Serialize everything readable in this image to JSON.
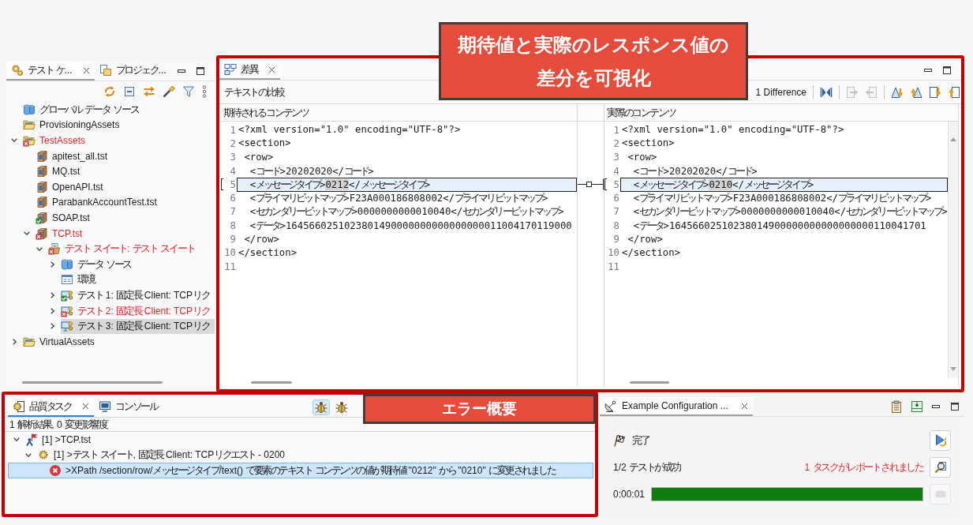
{
  "callouts": [
    {
      "text": "期待値と実際のレスポンス値の差分を可視化"
    },
    {
      "text": "エラー概要"
    }
  ],
  "test_explorer": {
    "tabs": [
      {
        "label": "テスト ケ...",
        "selected": true
      },
      {
        "label": "プロジェク...",
        "selected": false
      }
    ],
    "tree": [
      {
        "label": "グローバル データ ソース",
        "kind": "datasource",
        "failed": false,
        "passed": false,
        "selected": false
      },
      {
        "label": "ProvisioningAssets",
        "kind": "folder",
        "failed": false,
        "passed": false,
        "selected": false
      },
      {
        "label": "TestAssets",
        "kind": "folder",
        "failed": true,
        "passed": false,
        "expanded": true,
        "selected": false,
        "children": [
          {
            "label": "apitest_all.tst",
            "kind": "file",
            "failed": false,
            "passed": false,
            "selected": false
          },
          {
            "label": "MQ.tst",
            "kind": "file",
            "failed": false,
            "passed": false,
            "selected": false
          },
          {
            "label": "OpenAPI.tst",
            "kind": "file",
            "failed": false,
            "passed": false,
            "selected": false
          },
          {
            "label": "ParabankAccountTest.tst",
            "kind": "file",
            "failed": false,
            "passed": false,
            "selected": false
          },
          {
            "label": "SOAP.tst",
            "kind": "file",
            "failed": false,
            "passed": true,
            "selected": false
          },
          {
            "label": "TCP.tst",
            "kind": "file",
            "failed": true,
            "passed": false,
            "expanded": true,
            "selected": false,
            "children": [
              {
                "label": "テスト スイート: テスト スイート",
                "kind": "suite",
                "failed": true,
                "passed": false,
                "expanded": true,
                "selected": false,
                "children": [
                  {
                    "label": "データ ソース",
                    "kind": "datasource",
                    "failed": false,
                    "passed": false,
                    "expanded": false,
                    "selected": false
                  },
                  {
                    "label": "環境",
                    "kind": "environment",
                    "failed": false,
                    "passed": false,
                    "selected": false
                  },
                  {
                    "label": "テスト 1: 固定長 Client: TCPリク",
                    "kind": "test",
                    "failed": false,
                    "passed": true,
                    "expanded": false,
                    "selected": false
                  },
                  {
                    "label": "テスト 2: 固定長 Client: TCPリク",
                    "kind": "test",
                    "failed": true,
                    "passed": false,
                    "expanded": false,
                    "selected": false
                  },
                  {
                    "label": "テスト 3: 固定長 Client: TCPリク",
                    "kind": "test",
                    "failed": false,
                    "passed": false,
                    "expanded": false,
                    "selected": true
                  }
                ]
              }
            ]
          }
        ]
      },
      {
        "label": "VirtualAssets",
        "kind": "folder",
        "failed": false,
        "passed": false,
        "expanded": false,
        "selected": false
      }
    ]
  },
  "diff_view": {
    "tab": {
      "label": "差異",
      "selected": true
    },
    "title": "テキストの比較",
    "difference_count": "1 Difference",
    "toolbar": [
      {
        "kind": "copy_all",
        "disabled": false
      },
      {
        "kind": "copy_right",
        "disabled": true
      },
      {
        "kind": "copy_left",
        "disabled": true
      },
      {
        "kind": "next_difference",
        "disabled": false
      },
      {
        "kind": "previous_difference",
        "disabled": false
      },
      {
        "kind": "next_change",
        "disabled": false
      },
      {
        "kind": "previous_change",
        "disabled": false
      }
    ],
    "panes": [
      {
        "header": "期待されるコンテンツ",
        "lines": [
          {
            "number": "1",
            "text": "<?xml version=\"1.0\" encoding=\"UTF-8\"?>",
            "changed": false
          },
          {
            "number": "2",
            "text": "<section>",
            "changed": false
          },
          {
            "number": "3",
            "text": " <row>",
            "changed": false
          },
          {
            "number": "4",
            "text": "  <コード>20202020</コード>",
            "changed": false
          },
          {
            "number": "5",
            "text": "  <メッセージタイプ>",
            "diff": "0212",
            "tail": "</メッセージタイプ>",
            "changed": true
          },
          {
            "number": "6",
            "text": "  <プライマリビットマップ>F23A000186808002</プライマリビットマップ>",
            "changed": false
          },
          {
            "number": "7",
            "text": "  <セカンダリービットマップ>0000000000010040</セカンダリービットマップ>",
            "changed": false
          },
          {
            "number": "8",
            "text": "  <データ>1645660251023801490000000000000000011004170119000",
            "changed": false
          },
          {
            "number": "9",
            "text": " </row>",
            "changed": false
          },
          {
            "number": "10",
            "text": "</section>",
            "changed": false
          },
          {
            "number": "11",
            "changed": false
          }
        ]
      },
      {
        "header": "実際のコンテンツ",
        "lines": [
          {
            "number": "1",
            "text": "<?xml version=\"1.0\" encoding=\"UTF-8\"?>",
            "changed": false
          },
          {
            "number": "2",
            "text": "<section>",
            "changed": false
          },
          {
            "number": "3",
            "text": " <row>",
            "changed": false
          },
          {
            "number": "4",
            "text": "  <コード>20202020</コード>",
            "changed": false
          },
          {
            "number": "5",
            "text": "  <メッセージタイプ>",
            "diff": "0210",
            "tail": "</メッセージタイプ>",
            "changed": true
          },
          {
            "number": "6",
            "text": "  <プライマリビットマップ>F23A000186808002</プライマリビットマップ>",
            "changed": false
          },
          {
            "number": "7",
            "text": "  <セカンダリービットマップ>0000000000010040</セカンダリービットマップ>",
            "changed": false
          },
          {
            "number": "8",
            "text": "  <データ>16456602510238014900000000000000000110041701",
            "changed": false
          },
          {
            "number": "9",
            "text": " </row>",
            "changed": false
          },
          {
            "number": "10",
            "text": "</section>",
            "changed": false
          },
          {
            "number": "11",
            "changed": false
          }
        ]
      }
    ]
  },
  "quality_tasks": {
    "tabs": [
      {
        "label": "品質タスク",
        "selected": true
      },
      {
        "label": "コンソール",
        "selected": false
      }
    ],
    "toolbar": [
      {
        "pressed": true
      },
      {
        "pressed": false
      }
    ],
    "summary": "1 解析結果, 0 変更影響度",
    "tree": [
      {
        "label": "[1] >TCP.tst",
        "kind": "file",
        "expanded": true,
        "selected": false,
        "children": [
          {
            "label": "[1] >テスト スイート, 固定長 Client: TCPリクエスト - 0200",
            "kind": "test",
            "expanded": true,
            "selected": false,
            "children": [
              {
                "label": ">XPath /section/row/メッセージタイプ/text() で要素のテキスト コンテンツの値が期待値 \"0212\" から \"0210\" に変更されました",
                "kind": "error",
                "selected": true
              }
            ]
          }
        ]
      }
    ]
  },
  "run_view": {
    "tab": {
      "label": "Example Configuration ...",
      "selected": true
    },
    "status": "完了",
    "result": "1/2 テストが成功",
    "tasks_reported": "1 タスクがレポートされました",
    "elapsed": "0:00:01",
    "progress": {
      "level": 1
    },
    "actions": [
      {
        "kind": "rerun",
        "disabled": false
      },
      {
        "kind": "report",
        "disabled": false
      },
      {
        "kind": "stop",
        "disabled": true
      }
    ]
  }
}
